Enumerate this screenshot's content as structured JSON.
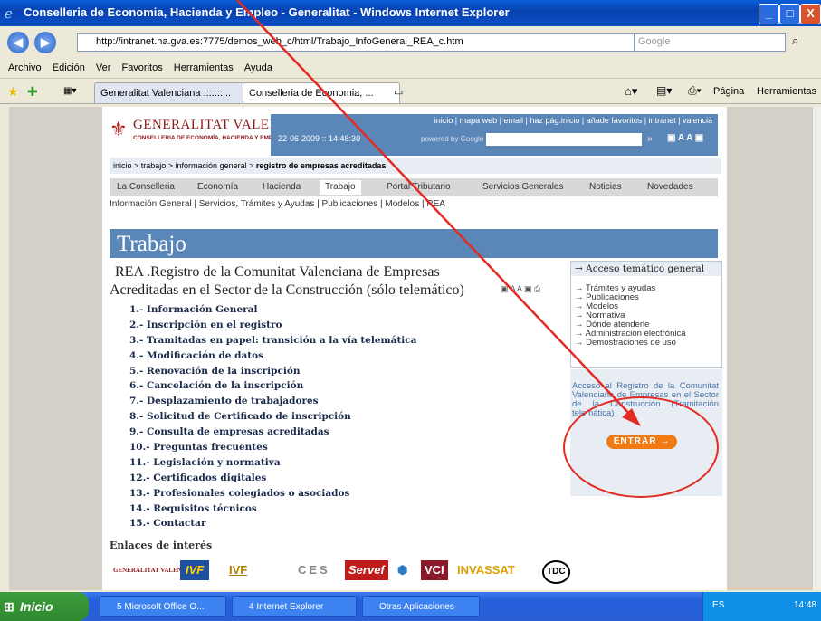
{
  "window": {
    "title": "Conselleria de Economia, Hacienda y Empleo - Generalitat - Windows Internet Explorer",
    "controls": [
      "_",
      "□",
      "X"
    ]
  },
  "address_bar": {
    "url": "http://intranet.ha.gva.es:7775/demos_web_c/html/Trabajo_InfoGeneral_REA_c.htm",
    "search_placeholder": "Google"
  },
  "menu": [
    "Archivo",
    "Edición",
    "Ver",
    "Favoritos",
    "Herramientas",
    "Ayuda"
  ],
  "tabs": [
    {
      "label": "Generalitat Valenciana :::::::...",
      "active": false
    },
    {
      "label": "Conselleria de Economia, ...",
      "active": true
    }
  ],
  "toolbar": {
    "pagina": "Página",
    "herramientas": "Herramientas"
  },
  "page": {
    "logo_main": "GENERALITAT VALENCIANA",
    "logo_sub": "CONSELLERIA DE ECONOMÍA, HACIENDA Y EMPLEO",
    "top_links": "inicio | mapa web | email | haz pág.inicio | añade favoritos | intranet | valencià",
    "datetime": "22-06-2009 :: 14:48:30",
    "powered": "powered by Google",
    "breadcrumb_plain": "inicio > trabajo > información general > ",
    "breadcrumb_bold": "registro de empresas acreditadas",
    "nav": [
      "La Conselleria",
      "Economía",
      "Hacienda",
      "Trabajo",
      "Portal Tributario",
      "Servicios Generales",
      "Noticias",
      "Novedades"
    ],
    "subnav": "Información General | Servicios, Trámites y Ayudas | Publicaciones | Modelos | REA",
    "banner": "Trabajo",
    "rea_title_1": "REA .Registro de la Comunitat Valenciana de Empresas",
    "rea_title_2": "Acreditadas en el Sector de la Construcción (sólo telemático)",
    "items": [
      "1.- Información General",
      "2.- Inscripción en el registro",
      "3.- Tramitadas en papel: transición a la vía telemática",
      "4.- Modificación de datos",
      "5.- Renovación de la inscripción",
      "6.- Cancelación de la inscripción",
      "7.- Desplazamiento de trabajadores",
      "8.- Solicitud de Certificado de inscripción",
      "9.- Consulta de empresas acreditadas",
      "10.- Preguntas frecuentes",
      "11.- Legislación y normativa",
      "12.- Certificados digitales",
      "13.- Profesionales colegiados o asociados",
      "14.- Requisitos técnicos",
      "15.- Contactar"
    ],
    "side_head": "Acceso temático general",
    "side_links": [
      "Trámites y ayudas",
      "Publicaciones",
      "Modelos",
      "Normativa",
      "Dónde atenderle",
      "Administración electrónica",
      "Demostraciones de uso"
    ],
    "access_text": "Acceso al Registro de la Comunitat Valenciana de Empresas en el Sector de la Construcción (Tramitación telemática)",
    "entrar": "ENTRAR →",
    "enlaces": "Enlaces de interés",
    "logos": [
      "GENERALITAT VALENCIANA",
      "IVF",
      "IVF",
      "CES",
      "Servef",
      "VCI",
      "INVASSAT",
      "TDC"
    ]
  },
  "taskbar": {
    "start": "Inicio",
    "items": [
      "5 Microsoft Office O...",
      "4 Internet Explorer",
      "Otras Aplicaciones"
    ],
    "lang": "ES",
    "clock": "14:48"
  },
  "colors": {
    "annotation": "#e32b24",
    "entrar": "#f07a14",
    "banner": "#5a87b8"
  }
}
